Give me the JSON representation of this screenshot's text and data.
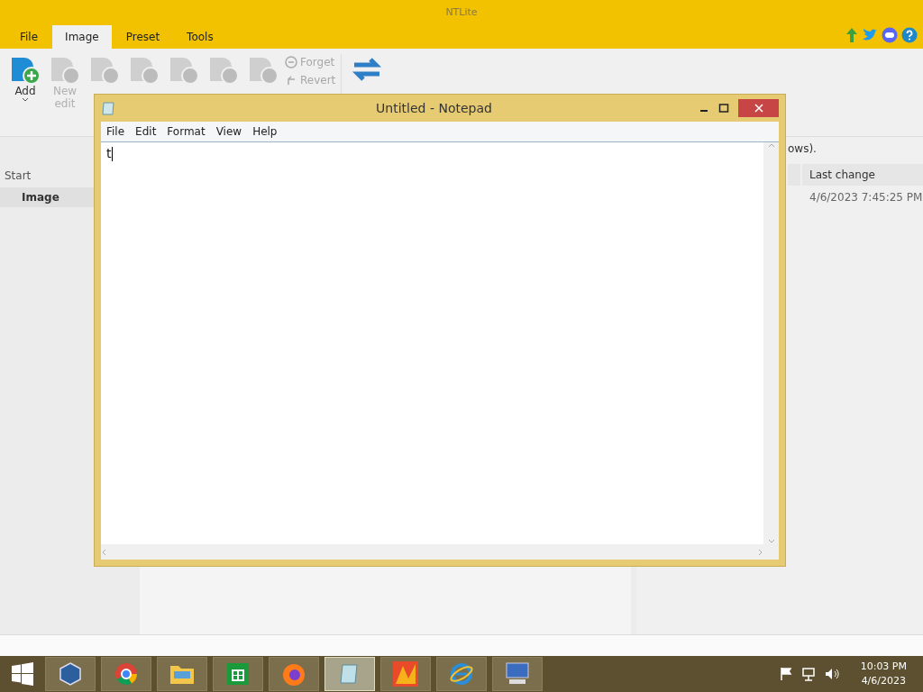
{
  "app_window": {
    "title": "NTLite",
    "tabs": [
      {
        "label": "File",
        "selected": false
      },
      {
        "label": "Image",
        "selected": true
      },
      {
        "label": "Preset",
        "selected": false
      },
      {
        "label": "Tools",
        "selected": false
      }
    ],
    "ribbon": {
      "buttons": [
        {
          "label": "Add",
          "disabled": false,
          "dropdown": true
        },
        {
          "label": "New edit",
          "disabled": true,
          "dropdown": false
        },
        {
          "disabled": true,
          "dropdown": false
        },
        {
          "disabled": true,
          "dropdown": false
        },
        {
          "disabled": true,
          "dropdown": false
        },
        {
          "disabled": true,
          "dropdown": false
        },
        {
          "disabled": true,
          "dropdown": false
        }
      ],
      "small_buttons": [
        {
          "label": "Forget",
          "disabled": true
        },
        {
          "label": "Revert",
          "disabled": true
        }
      ]
    },
    "sidebar": {
      "heading": "Start",
      "items": [
        {
          "label": "Image",
          "selected": true
        }
      ]
    },
    "info_text": "ows).",
    "table": {
      "columns": [
        "Last change"
      ],
      "rows": [
        [
          "4/6/2023 7:45:25 PM"
        ]
      ]
    }
  },
  "notepad": {
    "title": "Untitled - Notepad",
    "menu": [
      "File",
      "Edit",
      "Format",
      "View",
      "Help"
    ],
    "content": "t"
  },
  "taskbar": {
    "apps": [
      {
        "kind": "virtualbox",
        "active": false
      },
      {
        "kind": "chrome",
        "active": false
      },
      {
        "kind": "explorer",
        "active": false
      },
      {
        "kind": "store",
        "active": false
      },
      {
        "kind": "firefox",
        "active": false
      },
      {
        "kind": "notepad",
        "active": true
      },
      {
        "kind": "ntlite",
        "active": false
      },
      {
        "kind": "ie",
        "active": false
      },
      {
        "kind": "remote",
        "active": false
      }
    ],
    "time": "10:03 PM",
    "date": "4/6/2023"
  }
}
